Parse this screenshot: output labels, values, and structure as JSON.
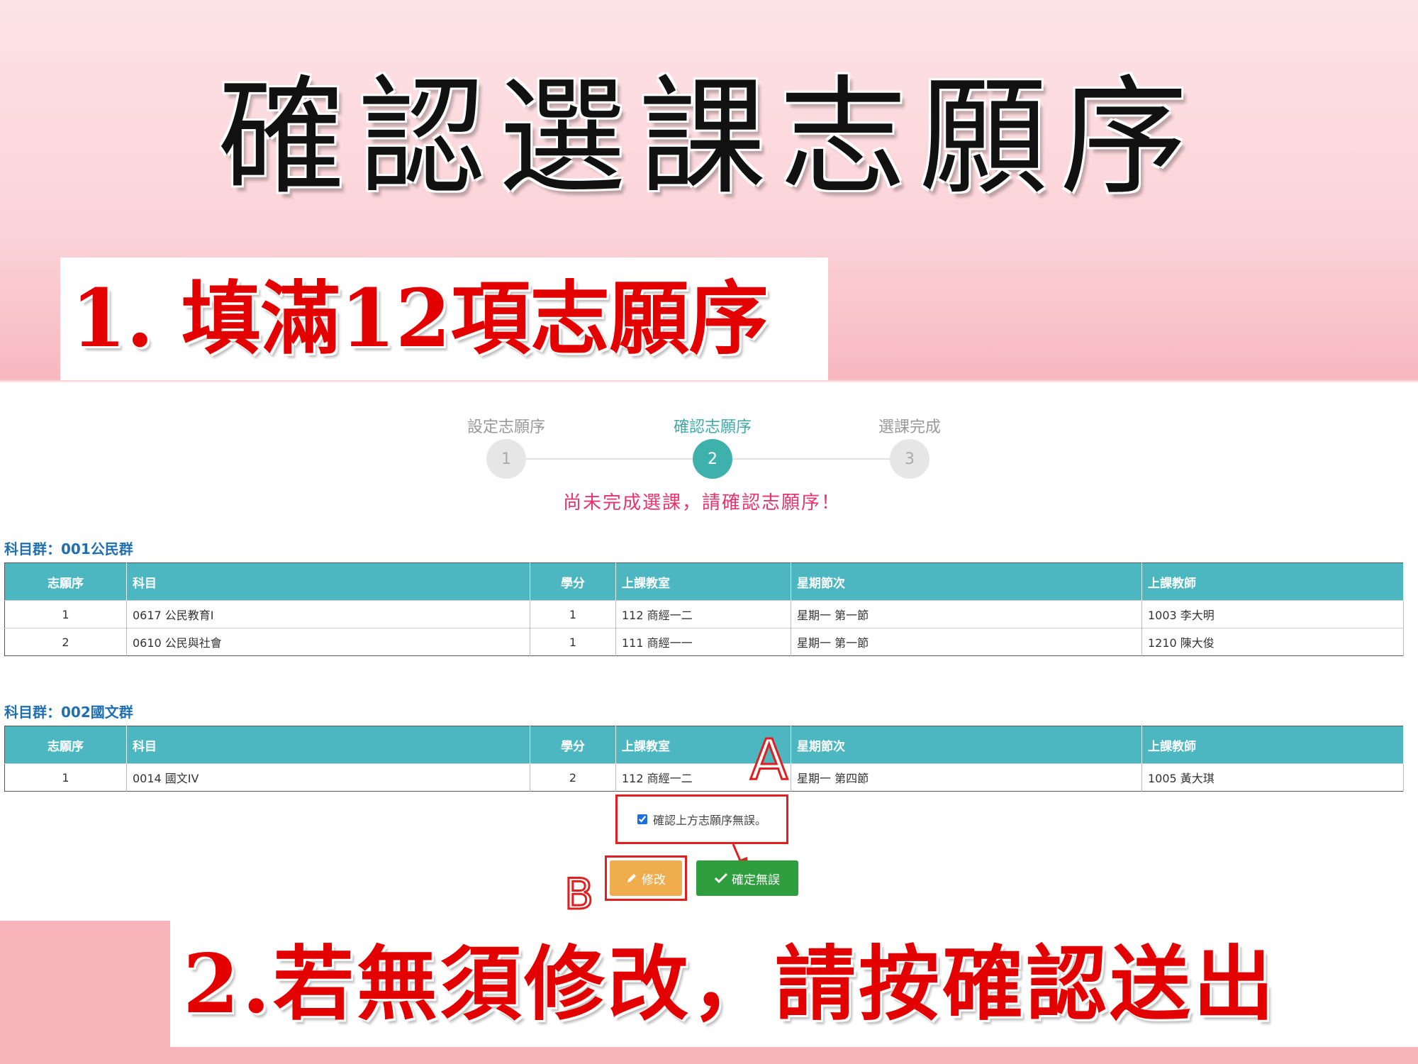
{
  "slide": {
    "title": "確認選課志願序",
    "caption1": "1. 填滿12項志願序",
    "caption2": "2.若無須修改，請按確認送出"
  },
  "stepper": {
    "steps": [
      {
        "label": "設定志願序",
        "number": "1"
      },
      {
        "label": "確認志願序",
        "number": "2"
      },
      {
        "label": "選課完成",
        "number": "3"
      }
    ],
    "active_step": 2,
    "warning": "尚未完成選課，請確認志願序！"
  },
  "columns": [
    "志願序",
    "科目",
    "學分",
    "上課教室",
    "星期節次",
    "上課教師"
  ],
  "groups": [
    {
      "label": "科目群：001公民群",
      "rows": [
        [
          "1",
          "0617 公民教育Ⅰ",
          "1",
          "112 商經一二",
          "星期一 第一節",
          "1003 李大明"
        ],
        [
          "2",
          "0610 公民與社會",
          "1",
          "111 商經一一",
          "星期一 第一節",
          "1210 陳大俊"
        ]
      ]
    },
    {
      "label": "科目群：002國文群",
      "rows": [
        [
          "1",
          "0014 國文IV",
          "2",
          "112 商經一二",
          "星期一 第四節",
          "1005 黃大琪"
        ]
      ]
    }
  ],
  "confirm": {
    "checkbox_label": "確認上方志願序無誤。",
    "checked": true
  },
  "buttons": {
    "edit_label": "修改",
    "confirm_label": "確定無誤"
  },
  "annotations": {
    "marker_a": "A",
    "marker_b": "B"
  },
  "colors": {
    "accent": "#4cb7c1",
    "warning": "#e8336d",
    "caption": "#e30000",
    "edit_button": "#f0ad4e",
    "confirm_button": "#2f9e3f",
    "annotation": "#e02020"
  }
}
